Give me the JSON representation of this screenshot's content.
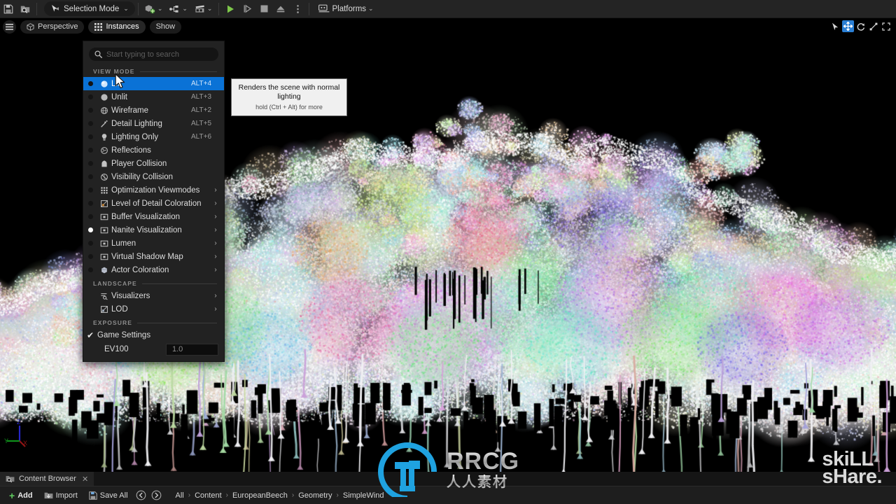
{
  "toolbar": {
    "save_icon": "save-icon",
    "browse_icon": "content-browse-icon",
    "mode_label": "Selection Mode",
    "mode_icon": "select-cursor-icon",
    "add_icon": "add-actor-icon",
    "blueprint_icon": "blueprint-icon",
    "cinematics_icon": "cinematics-icon",
    "play_icon": "play-icon",
    "skip_icon": "skip-frame-icon",
    "stop_icon": "stop-icon",
    "eject_icon": "eject-icon",
    "more_icon": "more-options-icon",
    "platforms_label": "Platforms",
    "platforms_icon": "platforms-icon",
    "caret": "⌄"
  },
  "viewport": {
    "hamburger_icon": "viewport-menu-icon",
    "perspective_label": "Perspective",
    "perspective_icon": "cube-icon",
    "instances_label": "Instances",
    "instances_icon": "instances-grid-icon",
    "show_label": "Show",
    "tools": [
      {
        "name": "select-tool",
        "icon": "arrow-cursor-icon",
        "active": false
      },
      {
        "name": "move-tool",
        "icon": "move-gizmo-icon",
        "active": true
      },
      {
        "name": "rotate-tool",
        "icon": "rotate-gizmo-icon",
        "active": false
      },
      {
        "name": "scale-tool",
        "icon": "scale-gizmo-icon",
        "active": false
      },
      {
        "name": "maximize-tool",
        "icon": "maximize-icon",
        "active": false
      }
    ],
    "gizmo": {
      "x_label": "X",
      "y_label": "Y",
      "z_label": "Z",
      "x_color": "#8c1f1f",
      "y_color": "#1f8c1f",
      "z_color": "#2222aa"
    }
  },
  "menu": {
    "search_placeholder": "Start typing to search",
    "search_value": "",
    "search_icon": "search-icon",
    "sections": [
      {
        "label": "VIEW MODE"
      },
      {
        "label": "LANDSCAPE"
      },
      {
        "label": "EXPOSURE"
      }
    ],
    "view_mode_items": [
      {
        "label": "Lit",
        "shortcut": "ALT+4",
        "icon": "lit-sphere-icon",
        "selected": true,
        "radio": false,
        "submenu": false
      },
      {
        "label": "Unlit",
        "shortcut": "ALT+3",
        "icon": "unlit-sphere-icon",
        "selected": false,
        "radio": false,
        "submenu": false
      },
      {
        "label": "Wireframe",
        "shortcut": "ALT+2",
        "icon": "wireframe-icon",
        "selected": false,
        "radio": false,
        "submenu": false
      },
      {
        "label": "Detail Lighting",
        "shortcut": "ALT+5",
        "icon": "detail-lighting-icon",
        "selected": false,
        "radio": false,
        "submenu": false
      },
      {
        "label": "Lighting Only",
        "shortcut": "ALT+6",
        "icon": "lightbulb-icon",
        "selected": false,
        "radio": false,
        "submenu": false
      },
      {
        "label": "Reflections",
        "shortcut": "",
        "icon": "reflections-icon",
        "selected": false,
        "radio": false,
        "submenu": false
      },
      {
        "label": "Player Collision",
        "shortcut": "",
        "icon": "player-collision-icon",
        "selected": false,
        "radio": false,
        "submenu": false
      },
      {
        "label": "Visibility Collision",
        "shortcut": "",
        "icon": "visibility-collision-icon",
        "selected": false,
        "radio": false,
        "submenu": false
      },
      {
        "label": "Optimization Viewmodes",
        "shortcut": "",
        "icon": "optimization-icon",
        "selected": false,
        "radio": false,
        "submenu": true
      },
      {
        "label": "Level of Detail Coloration",
        "shortcut": "",
        "icon": "lod-coloration-icon",
        "selected": false,
        "radio": false,
        "submenu": true
      },
      {
        "label": "Buffer Visualization",
        "shortcut": "",
        "icon": "buffer-viz-icon",
        "selected": false,
        "radio": false,
        "submenu": true
      },
      {
        "label": "Nanite Visualization",
        "shortcut": "",
        "icon": "nanite-viz-icon",
        "selected": false,
        "radio": true,
        "submenu": true
      },
      {
        "label": "Lumen",
        "shortcut": "",
        "icon": "lumen-icon",
        "selected": false,
        "radio": false,
        "submenu": true
      },
      {
        "label": "Virtual Shadow Map",
        "shortcut": "",
        "icon": "vsm-icon",
        "selected": false,
        "radio": false,
        "submenu": true
      },
      {
        "label": "Actor Coloration",
        "shortcut": "",
        "icon": "actor-coloration-icon",
        "selected": false,
        "radio": false,
        "submenu": true
      }
    ],
    "landscape_items": [
      {
        "label": "Visualizers",
        "icon": "visualizers-icon",
        "submenu": true
      },
      {
        "label": "LOD",
        "icon": "landscape-lod-icon",
        "submenu": true
      }
    ],
    "exposure": {
      "game_settings_label": "Game Settings",
      "game_settings_checked": true,
      "ev100_label": "EV100",
      "ev100_value": "1.0"
    }
  },
  "tooltip": {
    "title": "Renders the scene with normal lighting",
    "hint": "hold (Ctrl + Alt) for more"
  },
  "content_browser": {
    "tab_label": "Content Browser",
    "tab_icon": "content-browser-icon",
    "close_icon": "close-icon",
    "add_label": "Add",
    "import_label": "Import",
    "import_icon": "import-icon",
    "save_all_label": "Save All",
    "save_all_icon": "save-all-icon",
    "back_icon": "back-arrow-icon",
    "forward_icon": "forward-arrow-icon",
    "breadcrumb": [
      "All",
      "Content",
      "EuropeanBeech",
      "Geometry",
      "SimpleWind"
    ],
    "breadcrumb_sep": "›"
  },
  "watermarks": {
    "rrcg_text": "RRCG",
    "rrcg_cn": "人人素材",
    "rrcg_logo_color": "#1fa2e0",
    "skillshare_line1": "skiLL",
    "skillshare_line2": "sHare."
  },
  "scene": {
    "description": "nanite-instance-colored-foliage-viewport",
    "background": "#000000"
  }
}
